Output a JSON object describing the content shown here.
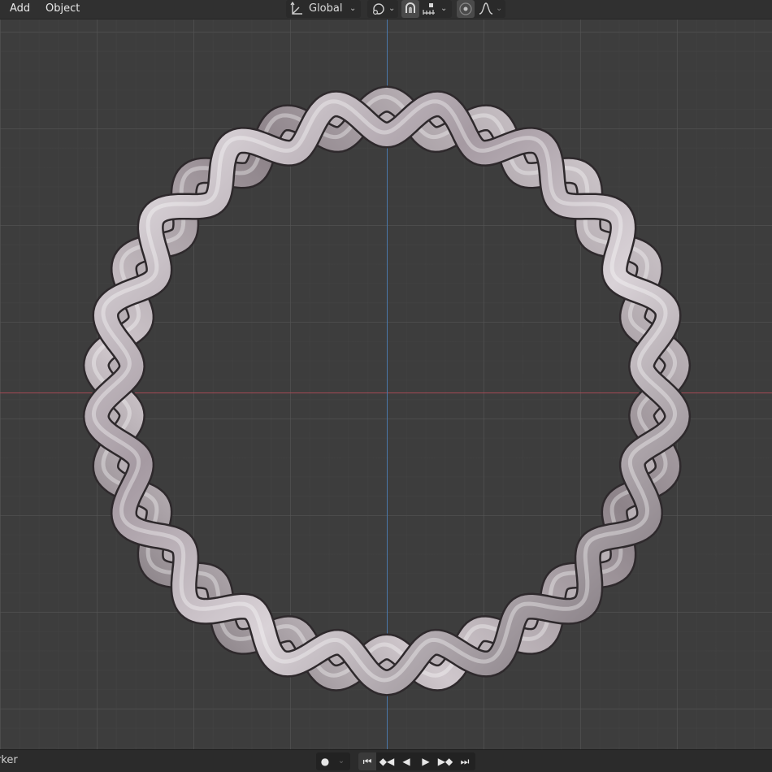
{
  "header": {
    "menus": [
      {
        "label": "Add"
      },
      {
        "label": "Object"
      }
    ],
    "transform_orientation": {
      "value": "Global"
    },
    "pivot_icon": "transform-pivot-icon",
    "snap_icon": "snap-magnet-icon",
    "snap_increment_icon": "snap-increment-icon",
    "proportional_icon": "proportional-editing-icon",
    "falloff_icon": "falloff-curve-icon"
  },
  "viewport": {
    "object": "twisted-chain-ring",
    "axis_colors": {
      "x": "#a54a55",
      "y": "#4a77a8"
    },
    "grid_color": "#565656",
    "background": "#3d3d3d"
  },
  "timeline": {
    "marker_label": "rker",
    "record_icon": "●",
    "buttons": [
      "⏮",
      "◆◀",
      "◀",
      "▶",
      "▶◆",
      "⏭"
    ]
  }
}
